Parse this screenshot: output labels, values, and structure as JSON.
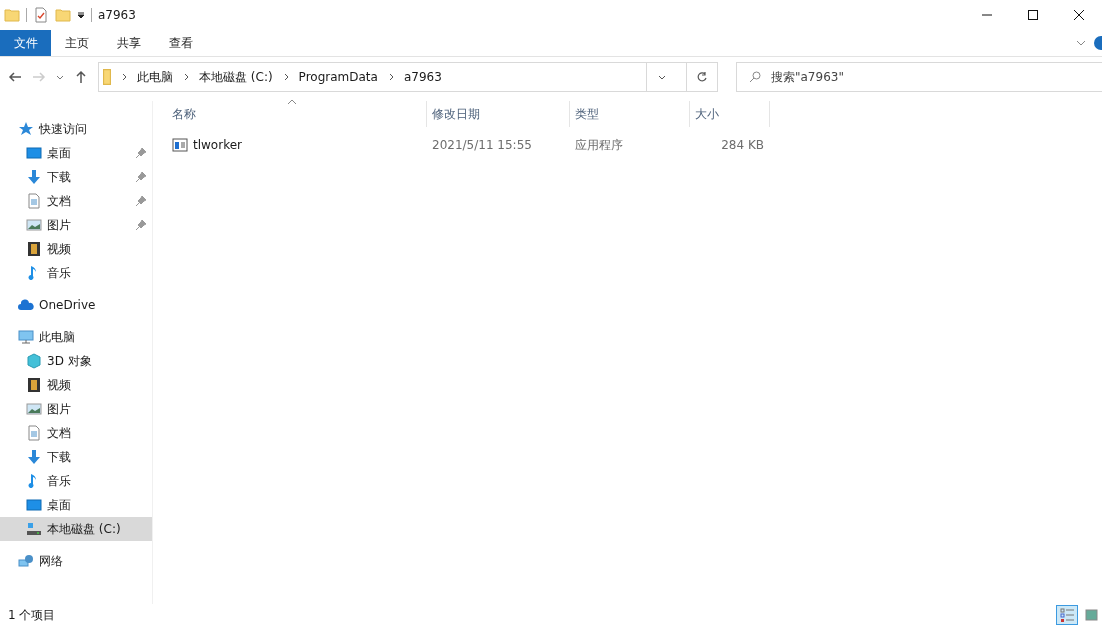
{
  "window": {
    "title": "a7963"
  },
  "ribbon_tabs": [
    {
      "label": "文件",
      "selected": true
    },
    {
      "label": "主页",
      "selected": false
    },
    {
      "label": "共享",
      "selected": false
    },
    {
      "label": "查看",
      "selected": false
    }
  ],
  "address_bar": {
    "path": [
      "此电脑",
      "本地磁盘 (C:)",
      "ProgramData",
      "a7963"
    ]
  },
  "search": {
    "placeholder": "搜索\"a7963\""
  },
  "sidebar": {
    "items": [
      {
        "label": "快速访问",
        "kind": "star",
        "selected": false,
        "children": [
          {
            "label": "桌面",
            "kind": "desktop",
            "pinned": true,
            "selected": false
          },
          {
            "label": "下载",
            "kind": "download",
            "pinned": true,
            "selected": false
          },
          {
            "label": "文档",
            "kind": "document",
            "pinned": true,
            "selected": false
          },
          {
            "label": "图片",
            "kind": "picture",
            "pinned": true,
            "selected": false
          },
          {
            "label": "视频",
            "kind": "video",
            "pinned": false,
            "selected": false
          },
          {
            "label": "音乐",
            "kind": "music",
            "pinned": false,
            "selected": false
          }
        ]
      },
      {
        "label": "OneDrive",
        "kind": "cloud",
        "selected": false
      },
      {
        "label": "此电脑",
        "kind": "pc",
        "selected": false,
        "children": [
          {
            "label": "3D 对象",
            "kind": "cube",
            "selected": false
          },
          {
            "label": "视频",
            "kind": "video",
            "selected": false
          },
          {
            "label": "图片",
            "kind": "picture",
            "selected": false
          },
          {
            "label": "文档",
            "kind": "document",
            "selected": false
          },
          {
            "label": "下载",
            "kind": "download",
            "selected": false
          },
          {
            "label": "音乐",
            "kind": "music",
            "selected": false
          },
          {
            "label": "桌面",
            "kind": "desktop",
            "selected": false
          },
          {
            "label": "本地磁盘 (C:)",
            "kind": "drive",
            "selected": true
          }
        ]
      },
      {
        "label": "网络",
        "kind": "network",
        "selected": false
      }
    ]
  },
  "table": {
    "columns": [
      {
        "label": "名称",
        "sorted": true
      },
      {
        "label": "修改日期",
        "sorted": false
      },
      {
        "label": "类型",
        "sorted": false
      },
      {
        "label": "大小",
        "sorted": false
      }
    ],
    "rows": [
      {
        "name": "tlworker",
        "modified": "2021/5/11 15:55",
        "type": "应用程序",
        "size": "284 KB",
        "selected": false
      }
    ]
  },
  "status_bar": {
    "item_count": "1 个项目"
  }
}
